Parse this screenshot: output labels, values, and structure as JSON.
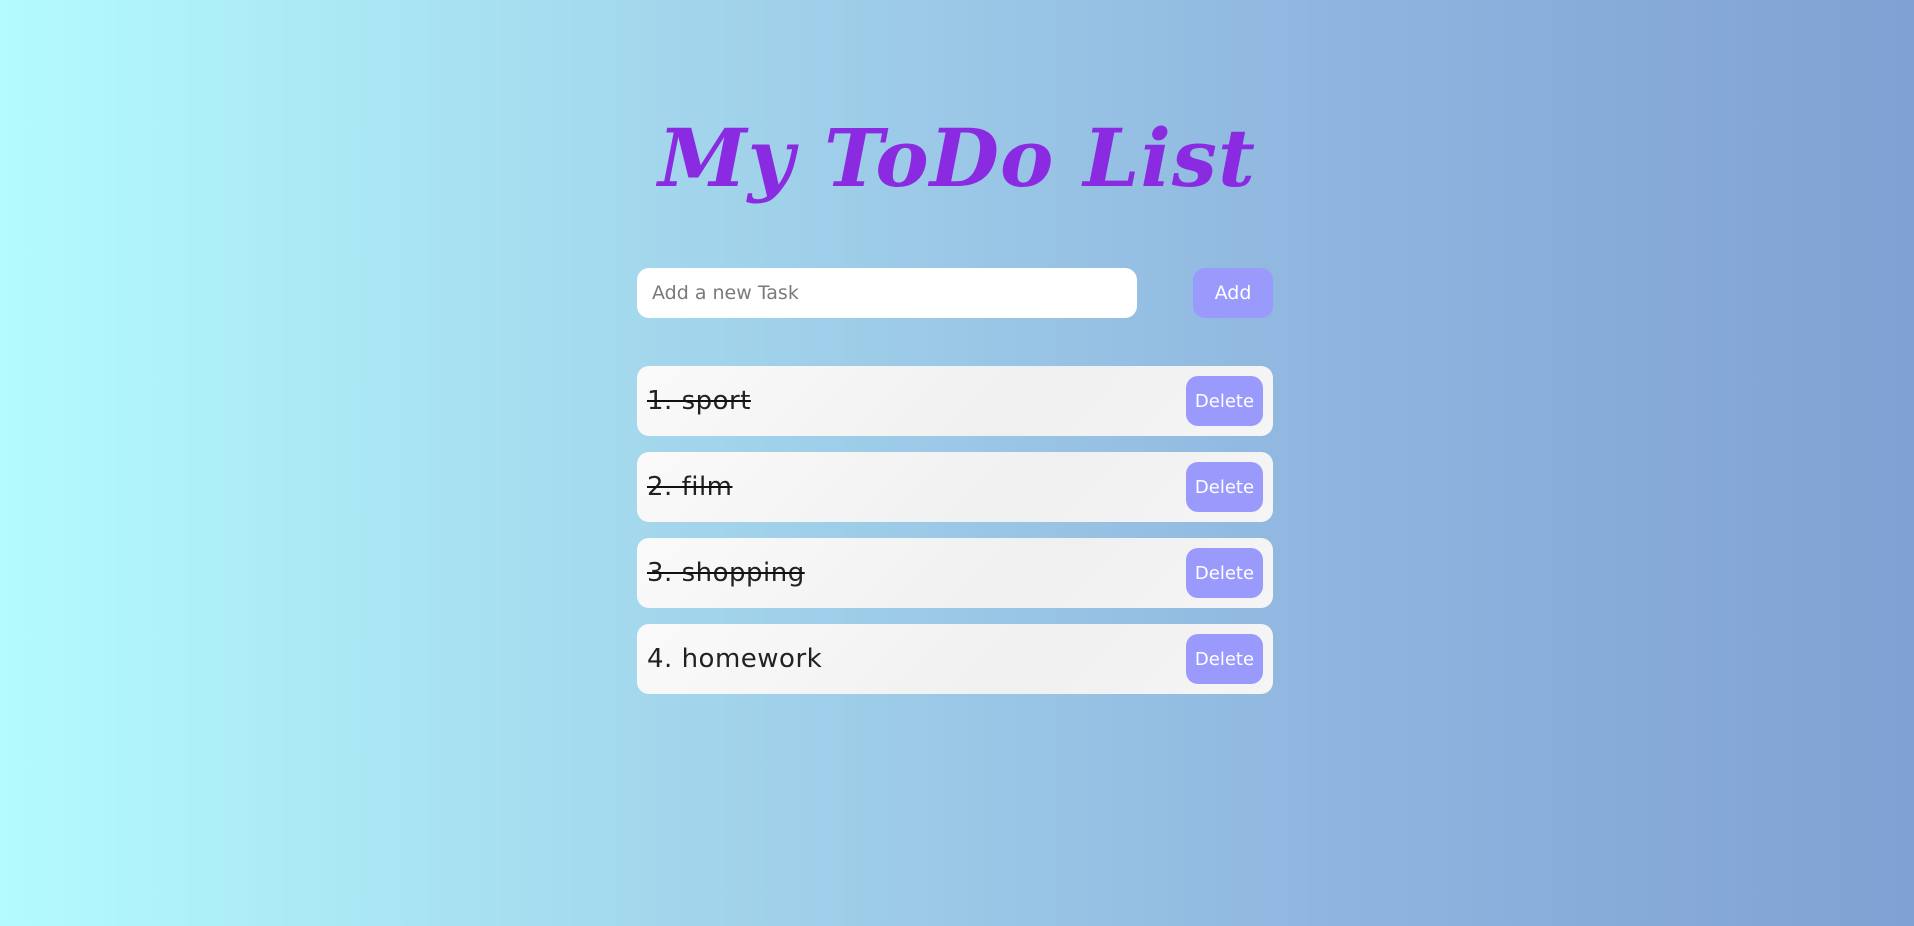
{
  "header": {
    "title": "My ToDo List"
  },
  "new_task": {
    "value": "",
    "placeholder": "Add a new Task",
    "add_label": "Add"
  },
  "tasks": [
    {
      "text": "1. sport",
      "completed": true,
      "delete_label": "Delete"
    },
    {
      "text": "2. film",
      "completed": true,
      "delete_label": "Delete"
    },
    {
      "text": "3. shopping",
      "completed": true,
      "delete_label": "Delete"
    },
    {
      "text": "4. homework",
      "completed": false,
      "delete_label": "Delete"
    }
  ],
  "colors": {
    "title": "#8a2be2",
    "button": "#9a9afd",
    "background_start": "#b3fbfe",
    "background_end": "#7fa1d3"
  }
}
